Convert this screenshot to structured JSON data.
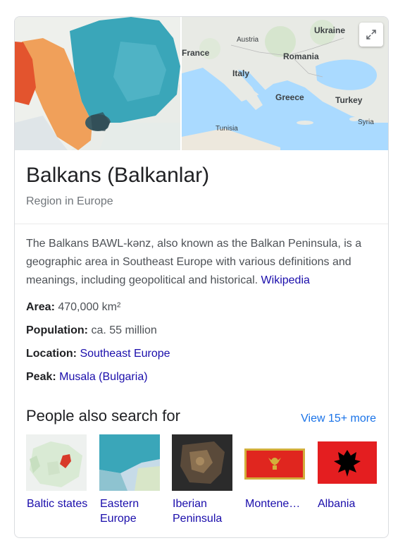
{
  "panel": {
    "title": "Balkans (Balkanlar)",
    "subtitle": "Region in Europe",
    "description": "The Balkans BAWL-kənz, also known as the Balkan Peninsula, is a geographic area in Southeast Europe with various definitions and meanings, including geopolitical and historical.",
    "source_link": "Wikipedia",
    "expand_icon": "expand-icon"
  },
  "map_labels": {
    "ukraine": "Ukraine",
    "austria": "Austria",
    "france": "France",
    "romania": "Romania",
    "italy": "Italy",
    "greece": "Greece",
    "turkey": "Turkey",
    "tunisia": "Tunisia",
    "syria": "Syria"
  },
  "facts": [
    {
      "label": "Area:",
      "value": "470,000 km²",
      "is_link": false
    },
    {
      "label": "Population:",
      "value": "ca. 55 million",
      "is_link": false
    },
    {
      "label": "Location:",
      "value": "Southeast Europe",
      "is_link": true
    },
    {
      "label": "Peak:",
      "value": "Musala (Bulgaria)",
      "is_link": true
    }
  ],
  "people_also_search": {
    "heading": "People also search for",
    "more_link": "View 15+ more",
    "items": [
      {
        "label": "Baltic states",
        "thumb": "baltic-map-thumbnail"
      },
      {
        "label": "Eastern Europe",
        "thumb": "eastern-europe-map-thumbnail"
      },
      {
        "label": "Iberian Peninsula",
        "thumb": "iberian-satellite-thumbnail"
      },
      {
        "label": "Montene…",
        "thumb": "montenegro-flag"
      },
      {
        "label": "Albania",
        "thumb": "albania-flag"
      }
    ]
  },
  "colors": {
    "link": "#1a0dab",
    "subtle_link": "#1a73e8",
    "sea": "#aadaff",
    "land": "#e8eae5",
    "balkan_orange": "#f0a05a",
    "balkan_teal": "#3aa6b9",
    "montenegro_red": "#e0261f",
    "montenegro_gold": "#d3ae3b",
    "albania_red": "#e41e20"
  }
}
